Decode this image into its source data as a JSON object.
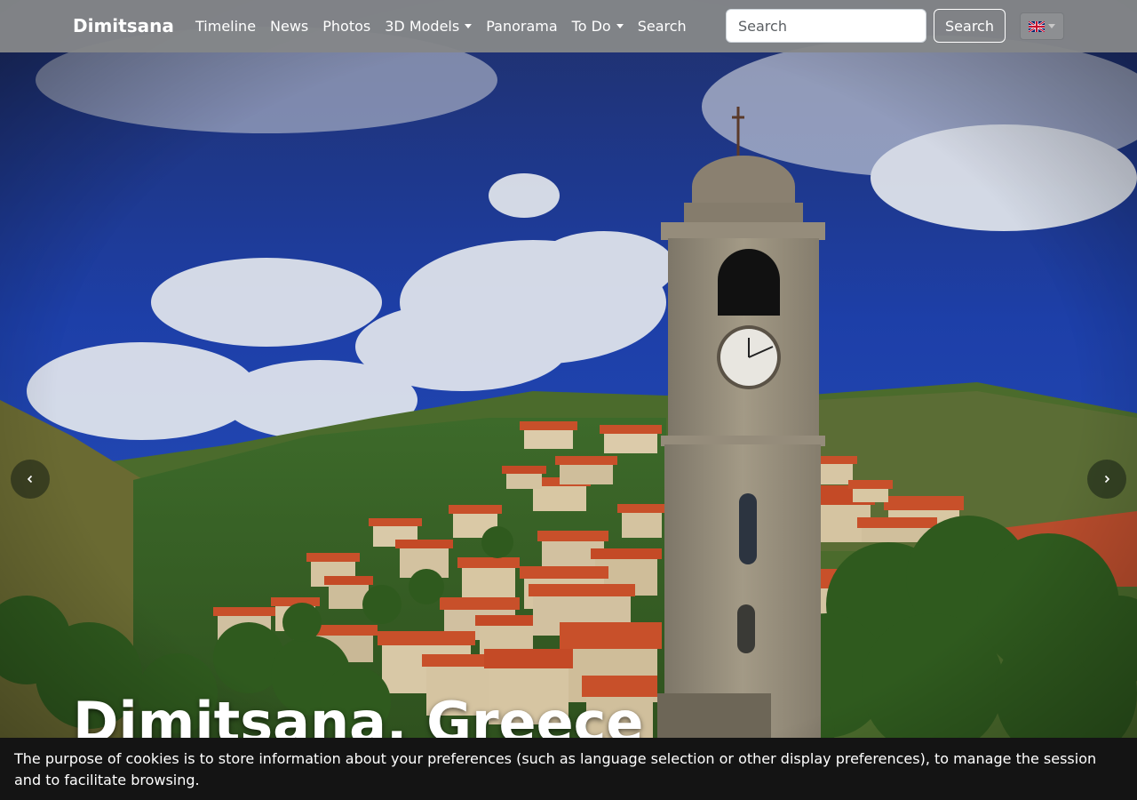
{
  "navbar": {
    "brand": "Dimitsana",
    "links": [
      {
        "label": "Timeline",
        "dropdown": false
      },
      {
        "label": "News",
        "dropdown": false
      },
      {
        "label": "Photos",
        "dropdown": false
      },
      {
        "label": "3D Models",
        "dropdown": true
      },
      {
        "label": "Panorama",
        "dropdown": false
      },
      {
        "label": "To Do",
        "dropdown": true
      },
      {
        "label": "Search",
        "dropdown": false
      }
    ],
    "search_placeholder": "Search",
    "search_button": "Search",
    "language_icon": "uk-flag-icon"
  },
  "carousel": {
    "caption": "Dimitsana, Greece",
    "prev_icon": "chevron-left-icon",
    "next_icon": "chevron-right-icon"
  },
  "cookie_notice": {
    "text": "The purpose of cookies is to store information about your preferences (such as language selection or other display preferences), to manage the session and to facilitate browsing."
  },
  "colors": {
    "navbar_bg": "#848688",
    "cookie_bg": "#141414",
    "sky": "#1a3f9e",
    "roof": "#c8502a"
  }
}
